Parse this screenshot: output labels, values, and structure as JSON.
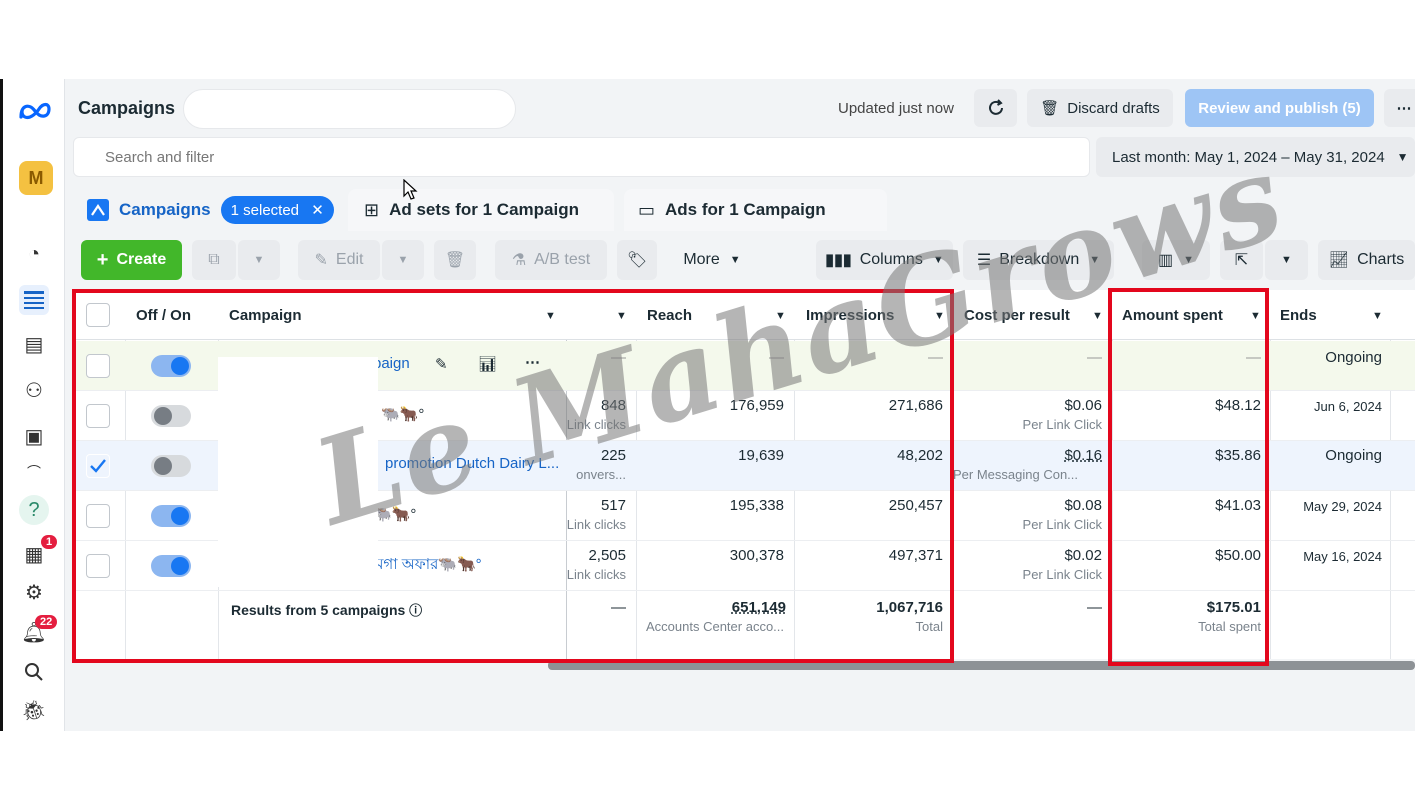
{
  "header": {
    "title": "Campaigns",
    "updated": "Updated just now",
    "discard_label": "Discard drafts",
    "review_label": "Review and publish (5)",
    "more_icon": "⋯"
  },
  "search": {
    "placeholder": "Search and filter"
  },
  "date_range": "Last month: May 1, 2024 – May 31, 2024",
  "tabs": {
    "campaigns": "Campaigns",
    "selected_chip": "1 selected",
    "adsets": "Ad sets for 1 Campaign",
    "ads": "Ads for 1 Campaign"
  },
  "toolbar": {
    "create": "Create",
    "edit": "Edit",
    "ab_test": "A/B test",
    "more": "More",
    "columns": "Columns",
    "breakdown": "Breakdown",
    "charts": "Charts"
  },
  "sidebar": {
    "avatar_letter": "M",
    "help": "?",
    "notifications_badge": "1",
    "alerts_badge": "22"
  },
  "table": {
    "headers": {
      "toggle": "Off / On",
      "campaign": "Campaign",
      "reach": "Reach",
      "impressions": "Impressions",
      "cost_per_result": "Cost per result",
      "amount_spent": "Amount spent",
      "ends": "Ends"
    },
    "rows": [
      {
        "name": "paign",
        "results": "—",
        "results_sub": "",
        "reach": "—",
        "impressions": "—",
        "cpr": "—",
        "cpr_sub": "",
        "spent": "—",
        "ends": "Ongoing",
        "on": true,
        "checked": false
      },
      {
        "name": "🐃🐂°",
        "results": "848",
        "results_sub": "Link clicks",
        "reach": "176,959",
        "impressions": "271,686",
        "cpr": "$0.06",
        "cpr_sub": "Per Link Click",
        "spent": "$48.12",
        "ends": "Jun 6, 2024",
        "on": false,
        "checked": false
      },
      {
        "name": "promotion Dutch Dairy L...",
        "results": "225",
        "results_sub": "onvers...",
        "reach": "19,639",
        "impressions": "48,202",
        "cpr": "$0.16",
        "cpr_sub": "Per Messaging Con...",
        "spent": "$35.86",
        "ends": "Ongoing",
        "on": false,
        "checked": true
      },
      {
        "name": "🐃🐂°",
        "results": "517",
        "results_sub": "Link clicks",
        "reach": "195,338",
        "impressions": "250,457",
        "cpr": "$0.08",
        "cpr_sub": "Per Link Click",
        "spent": "$41.03",
        "ends": "May 29, 2024",
        "on": true,
        "checked": false
      },
      {
        "name": "মেগা অফার🐃🐂°",
        "results": "2,505",
        "results_sub": "Link clicks",
        "reach": "300,378",
        "impressions": "497,371",
        "cpr": "$0.02",
        "cpr_sub": "Per Link Click",
        "spent": "$50.00",
        "ends": "May 16, 2024",
        "on": true,
        "checked": false
      }
    ],
    "totals": {
      "label": "Results from 5 campaigns",
      "results": "—",
      "reach": "651,149",
      "reach_sub": "Accounts Center acco...",
      "impressions": "1,067,716",
      "impressions_sub": "Total",
      "cpr": "—",
      "spent": "$175.01",
      "spent_sub": "Total spent"
    }
  },
  "watermark": "Le MahaGrows",
  "colors": {
    "accent": "#1877f2",
    "create_green": "#42b72a",
    "highlight_red": "#e3071d"
  }
}
